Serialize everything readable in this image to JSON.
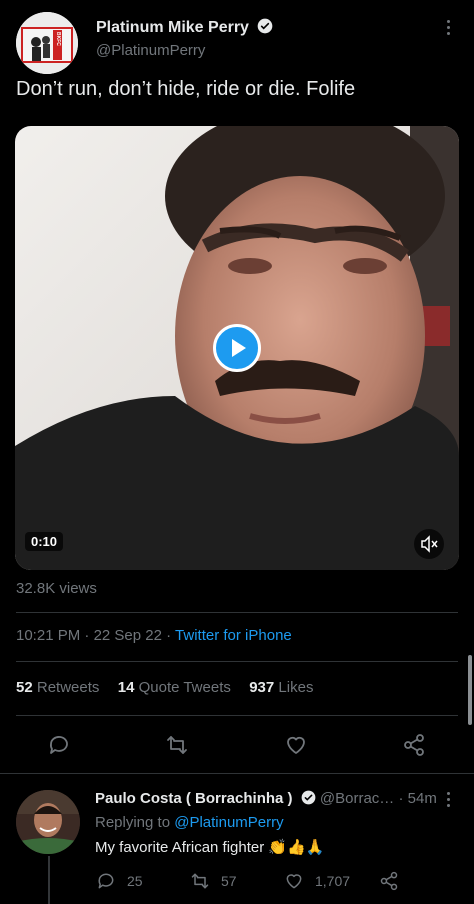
{
  "tweet": {
    "display_name": "Platinum Mike Perry",
    "handle": "@PlatinumPerry",
    "avatar_text": "BKFC",
    "text": "Don’t run, don’t hide, ride or die. Folife",
    "video": {
      "duration": "0:10"
    },
    "views": "32.8K views",
    "time": "10:21 PM",
    "date": "22 Sep 22",
    "source": "Twitter for iPhone",
    "stats": {
      "retweets_count": "52",
      "retweets_label": "Retweets",
      "quotes_count": "14",
      "quotes_label": "Quote Tweets",
      "likes_count": "937",
      "likes_label": "Likes"
    },
    "actions": [
      "reply-icon",
      "retweet-icon",
      "like-icon",
      "share-icon"
    ]
  },
  "reply": {
    "display_name": "Paulo Costa ( Borrachinha )",
    "handle": "@Borrac…",
    "time_sep": "·",
    "time": "54m",
    "replying_label": "Replying to",
    "replying_to": "@PlatinumPerry",
    "text": "My favorite African fighter",
    "emojis": "👏👍🙏",
    "counts": {
      "replies": "25",
      "retweets": "57",
      "likes": "1,707"
    }
  },
  "colors": {
    "accent": "#1d9bf0",
    "muted": "#71767b",
    "divider": "#2f3336"
  }
}
